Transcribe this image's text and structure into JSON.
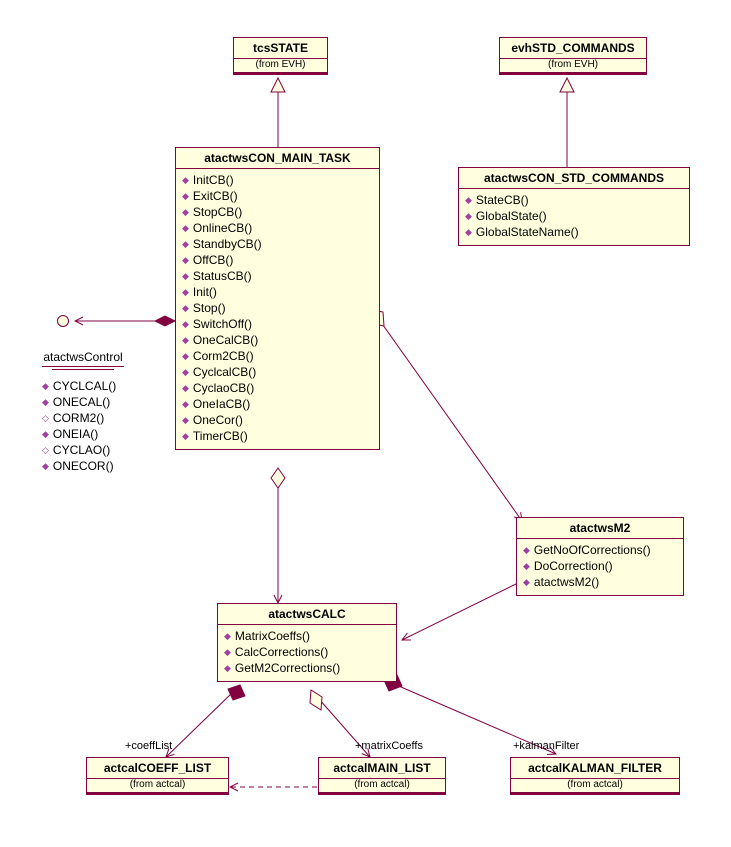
{
  "classes": {
    "tcsSTATE": {
      "name": "tcsSTATE",
      "from": "(from EVH)",
      "ops": []
    },
    "evhSTD_COMMANDS": {
      "name": "evhSTD_COMMANDS",
      "from": "(from EVH)",
      "ops": []
    },
    "atactwsCON_STD_COMMANDS": {
      "name": "atactwsCON_STD_COMMANDS",
      "ops": [
        "StateCB()",
        "GlobalState()",
        "GlobalStateName()"
      ]
    },
    "atactwsCON_MAIN_TASK": {
      "name": "atactwsCON_MAIN_TASK",
      "ops": [
        "InitCB()",
        "ExitCB()",
        "StopCB()",
        "OnlineCB()",
        "StandbyCB()",
        "OffCB()",
        "StatusCB()",
        "Init()",
        "Stop()",
        "SwitchOff()",
        "OneCalCB()",
        "Corm2CB()",
        "CyclcalCB()",
        "CyclaoCB()",
        "OneIaCB()",
        "OneCor()",
        "TimerCB()"
      ]
    },
    "atactwsM2": {
      "name": "atactwsM2",
      "ops": [
        "GetNoOfCorrections()",
        "DoCorrection()",
        "atactwsM2()"
      ]
    },
    "atactwsCALC": {
      "name": "atactwsCALC",
      "ops": [
        "MatrixCoeffs()",
        "CalcCorrections()",
        "GetM2Corrections()"
      ]
    },
    "actcalCOEFF_LIST": {
      "name": "actcalCOEFF_LIST",
      "from": "(from actcal)"
    },
    "actcalMAIN_LIST": {
      "name": "actcalMAIN_LIST",
      "from": "(from actcal)"
    },
    "actcalKALMAN_FILTER": {
      "name": "actcalKALMAN_FILTER",
      "from": "(from actcal)"
    }
  },
  "package": {
    "name": "atactwsControl",
    "ops": [
      "CYCLCAL()",
      "ONECAL()",
      "CORM2()",
      "ONEIA()",
      "CYCLAO()",
      "ONECOR()"
    ]
  },
  "roles": {
    "coeffList": "+coeffList",
    "matrixCoeffs": "+matrixCoeffs",
    "kalmanFilter": "+kalmanFilter"
  },
  "chart_data": {
    "type": "uml_class_diagram",
    "classes": [
      {
        "name": "tcsSTATE",
        "stereotype_from": "EVH",
        "operations": []
      },
      {
        "name": "evhSTD_COMMANDS",
        "stereotype_from": "EVH",
        "operations": []
      },
      {
        "name": "atactwsCON_STD_COMMANDS",
        "operations": [
          "StateCB()",
          "GlobalState()",
          "GlobalStateName()"
        ]
      },
      {
        "name": "atactwsCON_MAIN_TASK",
        "operations": [
          "InitCB()",
          "ExitCB()",
          "StopCB()",
          "OnlineCB()",
          "StandbyCB()",
          "OffCB()",
          "StatusCB()",
          "Init()",
          "Stop()",
          "SwitchOff()",
          "OneCalCB()",
          "Corm2CB()",
          "CyclcalCB()",
          "CyclaoCB()",
          "OneIaCB()",
          "OneCor()",
          "TimerCB()"
        ]
      },
      {
        "name": "atactwsM2",
        "operations": [
          "GetNoOfCorrections()",
          "DoCorrection()",
          "atactwsM2()"
        ]
      },
      {
        "name": "atactwsCALC",
        "operations": [
          "MatrixCoeffs()",
          "CalcCorrections()",
          "GetM2Corrections()"
        ]
      },
      {
        "name": "actcalCOEFF_LIST",
        "stereotype_from": "actcal",
        "operations": []
      },
      {
        "name": "actcalMAIN_LIST",
        "stereotype_from": "actcal",
        "operations": []
      },
      {
        "name": "actcalKALMAN_FILTER",
        "stereotype_from": "actcal",
        "operations": []
      }
    ],
    "package": {
      "name": "atactwsControl",
      "operations": [
        "CYCLCAL()",
        "ONECAL()",
        "CORM2()",
        "ONEIA()",
        "CYCLAO()",
        "ONECOR()"
      ]
    },
    "relationships": [
      {
        "type": "generalization",
        "from": "atactwsCON_MAIN_TASK",
        "to": "tcsSTATE"
      },
      {
        "type": "generalization",
        "from": "atactwsCON_STD_COMMANDS",
        "to": "evhSTD_COMMANDS"
      },
      {
        "type": "aggregation",
        "whole": "atactwsCON_MAIN_TASK",
        "part": "atactwsCALC"
      },
      {
        "type": "aggregation",
        "whole": "atactwsCON_MAIN_TASK",
        "part": "atactwsM2"
      },
      {
        "type": "aggregation",
        "whole": "atactwsM2",
        "part": "atactwsCALC"
      },
      {
        "type": "composition",
        "whole": "atactwsCON_MAIN_TASK",
        "part": "atactwsControl (interface)"
      },
      {
        "type": "composition",
        "whole": "atactwsCALC",
        "part": "actcalCOEFF_LIST",
        "role": "+coeffList"
      },
      {
        "type": "aggregation",
        "whole": "atactwsCALC",
        "part": "actcalMAIN_LIST",
        "role": "+matrixCoeffs"
      },
      {
        "type": "composition",
        "whole": "atactwsCALC",
        "part": "actcalKALMAN_FILTER",
        "role": "+kalmanFilter"
      },
      {
        "type": "dependency",
        "from": "actcalMAIN_LIST",
        "to": "actcalCOEFF_LIST"
      }
    ]
  }
}
